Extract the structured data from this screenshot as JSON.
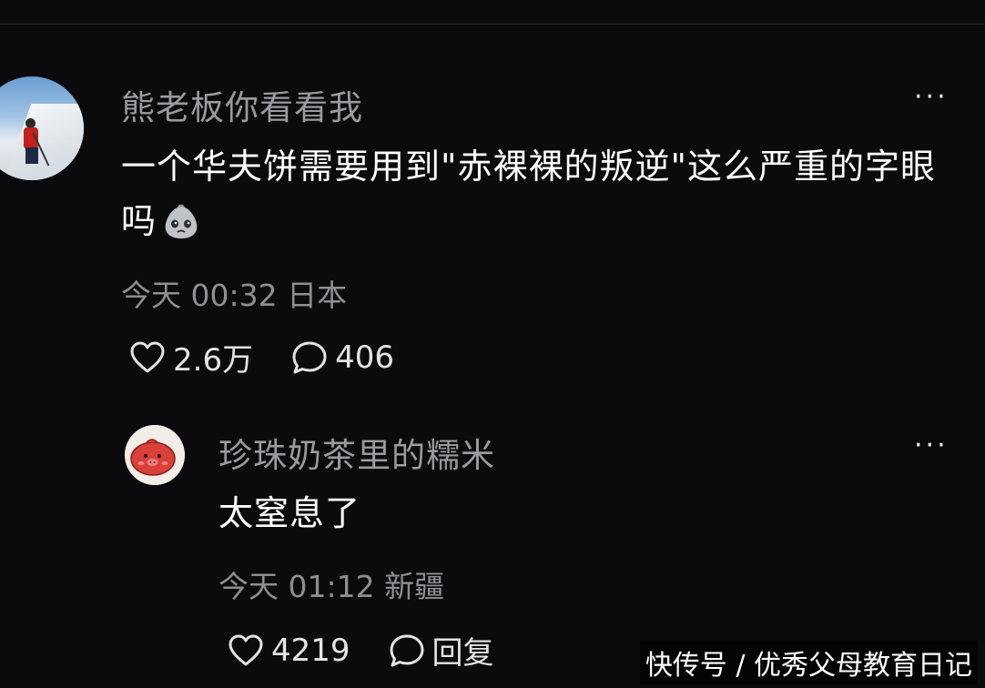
{
  "comment": {
    "username": "熊老板你看看我",
    "text": "一个华夫饼需要用到\"赤裸裸的叛逆\"这么严重的字眼吗",
    "emoji": "sad-face-emoji",
    "time": "今天 00:32",
    "location": "日本",
    "likes": "2.6万",
    "replies": "406",
    "more": "···"
  },
  "reply": {
    "username": "珍珠奶茶里的糯米",
    "text": "太窒息了",
    "time": "今天 01:12",
    "location": "新疆",
    "likes": "4219",
    "reply_label": "回复",
    "more": "···"
  },
  "watermark": "快传号 / 优秀父母教育日记",
  "icons": {
    "like": "heart-outline-icon",
    "comment": "speech-bubble-icon",
    "more": "more-dots-icon"
  },
  "colors": {
    "background": "#0b0b0d",
    "username": "#9a9aa0",
    "meta": "#8e8e94",
    "text": "#ffffff"
  }
}
